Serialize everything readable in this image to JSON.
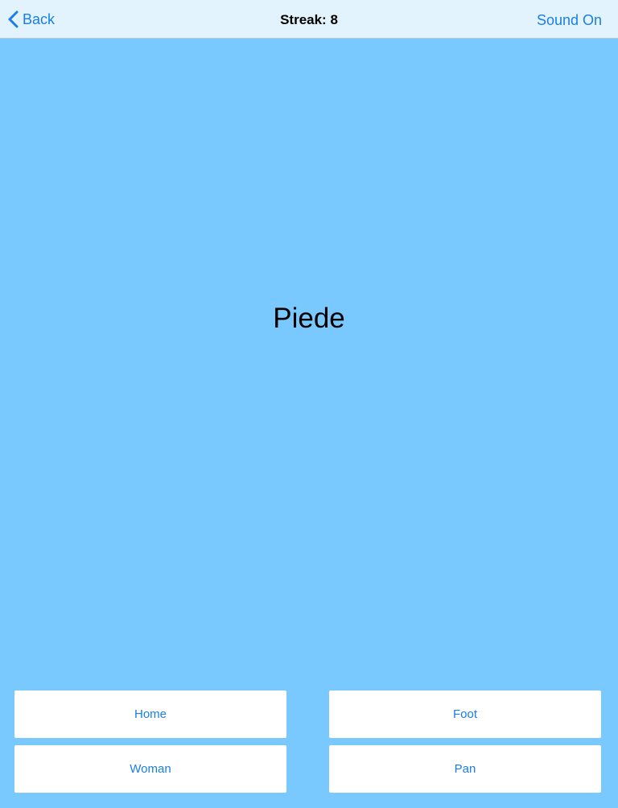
{
  "nav": {
    "back_label": "Back",
    "title": "Streak: 8",
    "sound_label": "Sound On"
  },
  "quiz": {
    "word": "Piede",
    "answers": [
      "Home",
      "Foot",
      "Woman",
      "Pan"
    ]
  },
  "colors": {
    "background": "#79c9ff",
    "navbar": "#e3f3fd",
    "accent": "#1a7ee6"
  },
  "icons": {
    "back": "chevron-left-icon"
  }
}
